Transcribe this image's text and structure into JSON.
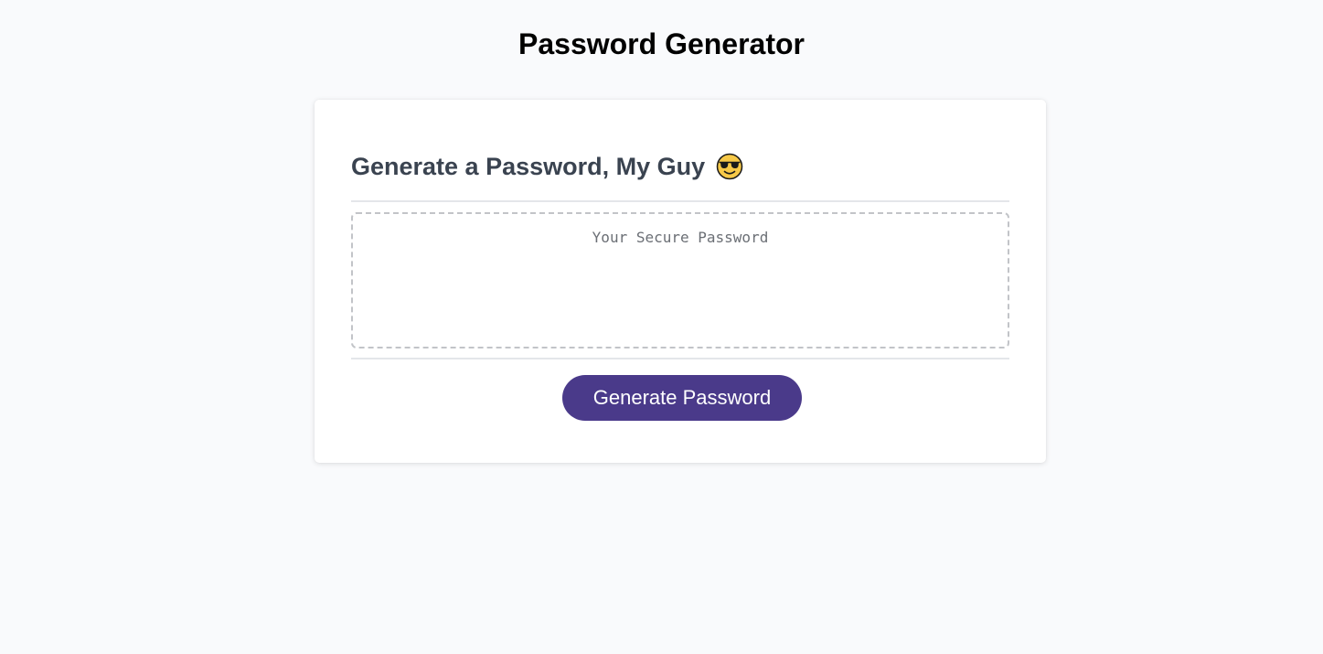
{
  "page": {
    "title": "Password Generator",
    "background_color": "#f9fafc"
  },
  "card": {
    "header_title": "Generate a Password, My Guy",
    "header_icon": "smiling-face-with-sunglasses-icon",
    "password_field": {
      "placeholder": "Your Secure Password",
      "value": ""
    },
    "generate_button_label": "Generate Password",
    "accent_color": "#4a3a8a"
  }
}
